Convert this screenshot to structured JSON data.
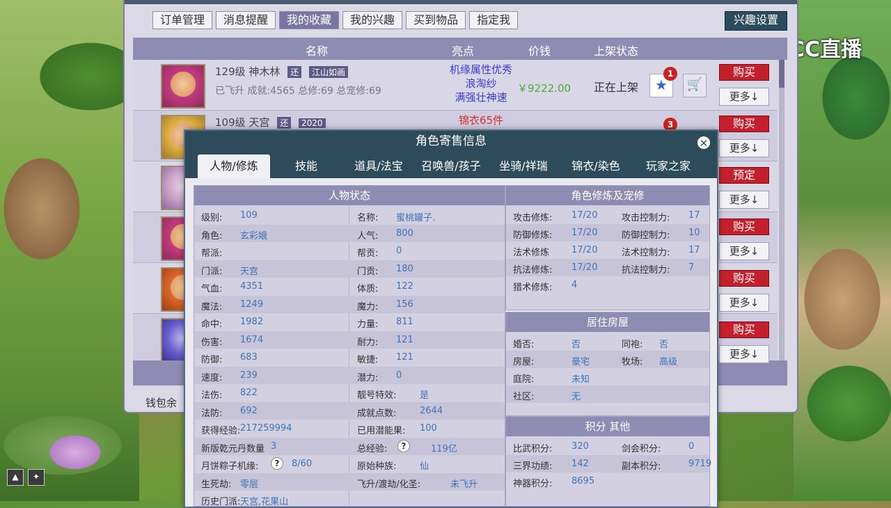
{
  "brand": {
    "logo_text": "CC直播"
  },
  "main": {
    "tabs": [
      {
        "label": "订单管理",
        "active": false
      },
      {
        "label": "消息提醒",
        "active": false
      },
      {
        "label": "我的收藏",
        "active": true
      },
      {
        "label": "我的兴趣",
        "active": false
      },
      {
        "label": "买到物品",
        "active": false
      },
      {
        "label": "指定我",
        "active": false
      }
    ],
    "interest_button": "兴趣设置",
    "columns": {
      "name": "名称",
      "highlight": "亮点",
      "price": "价钱",
      "status": "上架状态"
    },
    "rows": [
      {
        "level": "129级",
        "name": "神木林",
        "badge1": "还",
        "badge2": "江山如画",
        "meta": "已飞升  成就:4565  总修:69  总宠修:69",
        "highlights": [
          "机缘属性优秀",
          "浪淘纱",
          "满强壮神速"
        ],
        "price": "￥9222.00",
        "status": "正在上架",
        "fav_count": "1",
        "buy": "购买",
        "more": "更多↓"
      },
      {
        "level": "109级",
        "name": "天宫",
        "badge1": "还",
        "badge2": "2020",
        "meta": "",
        "highlights": [
          "锦衣65件"
        ],
        "price": "",
        "status": "",
        "fav_count": "3",
        "buy": "购买",
        "more": "更多↓"
      }
    ],
    "side_buttons": [
      {
        "buy": "购买",
        "more": "更多↓"
      },
      {
        "buy": "购买",
        "more": "更多↓"
      },
      {
        "buy": "预定",
        "more": "更多↓"
      },
      {
        "buy": "购买",
        "more": "更多↓"
      },
      {
        "buy": "购买",
        "more": "更多↓"
      },
      {
        "buy": "购买",
        "more": "更多↓"
      }
    ],
    "wallet_label": "钱包余"
  },
  "modal": {
    "title": "角色寄售信息",
    "tabs": [
      "人物/修炼",
      "技能",
      "道具/法宝",
      "召唤兽/孩子",
      "坐骑/祥瑞",
      "锦衣/染色",
      "玩家之家"
    ],
    "status_title": "人物状态",
    "status_left": [
      {
        "k": "级别:",
        "v": "109"
      },
      {
        "k": "角色:",
        "v": "玄彩娥"
      },
      {
        "k": "帮派:",
        "v": ""
      },
      {
        "k": "门派:",
        "v": "天宫"
      },
      {
        "k": "气血:",
        "v": "4351"
      },
      {
        "k": "魔法:",
        "v": "1249"
      },
      {
        "k": "命中:",
        "v": "1982"
      },
      {
        "k": "伤害:",
        "v": "1674"
      },
      {
        "k": "防御:",
        "v": "683"
      },
      {
        "k": "速度:",
        "v": "239"
      },
      {
        "k": "法伤:",
        "v": "822"
      },
      {
        "k": "法防:",
        "v": "692"
      },
      {
        "k": "获得经验:",
        "v": "217259994"
      },
      {
        "k": "新版乾元丹数量",
        "v": "3"
      },
      {
        "k": "月饼粽子机缘:",
        "v": "8/60",
        "q": true
      },
      {
        "k": "生死劫:",
        "v": "零层"
      },
      {
        "k": "历史门派:",
        "v": "天宫,花果山"
      }
    ],
    "status_right": [
      {
        "k": "名称:",
        "v": "蜜桃罐子."
      },
      {
        "k": "人气:",
        "v": "800"
      },
      {
        "k": "帮贡:",
        "v": "0"
      },
      {
        "k": "门贡:",
        "v": "180"
      },
      {
        "k": "体质:",
        "v": "122"
      },
      {
        "k": "魔力:",
        "v": "156"
      },
      {
        "k": "力量:",
        "v": "811"
      },
      {
        "k": "耐力:",
        "v": "121"
      },
      {
        "k": "敏捷:",
        "v": "121"
      },
      {
        "k": "潜力:",
        "v": "0"
      },
      {
        "k": "靓号特效:",
        "v": "是"
      },
      {
        "k": "成就点数:",
        "v": "2644"
      },
      {
        "k": "已用潜能果:",
        "v": "100"
      },
      {
        "k": "总经验:",
        "v": "119亿",
        "q": true
      },
      {
        "k": "原始种族:",
        "v": "仙"
      },
      {
        "k": "飞升/渡劫/化圣:",
        "v": "未飞升"
      }
    ],
    "cultivation_title": "角色修炼及宠修",
    "cultivation": [
      {
        "k1": "攻击修炼:",
        "v1": "17/20",
        "k2": "攻击控制力:",
        "v2": "17"
      },
      {
        "k1": "防御修炼:",
        "v1": "17/20",
        "k2": "防御控制力:",
        "v2": "10"
      },
      {
        "k1": "法术修炼",
        "v1": "17/20",
        "k2": "法术控制力:",
        "v2": "17"
      },
      {
        "k1": "抗法修炼:",
        "v1": "17/20",
        "k2": "抗法控制力:",
        "v2": "7"
      },
      {
        "k1": "猎术修炼:",
        "v1": "4",
        "k2": "",
        "v2": ""
      }
    ],
    "house_title": "居住房屋",
    "house": [
      {
        "k1": "婚否:",
        "v1": "否",
        "k2": "同袍:",
        "v2": "否"
      },
      {
        "k1": "房屋:",
        "v1": "豪宅",
        "k2": "牧场:",
        "v2": "高级"
      },
      {
        "k1": "庭院:",
        "v1": "未知",
        "k2": "",
        "v2": ""
      },
      {
        "k1": "社区:",
        "v1": "无",
        "k2": "",
        "v2": ""
      }
    ],
    "score_title": "积分 其他",
    "score": [
      {
        "k1": "比武积分:",
        "v1": "320",
        "k2": "剑会积分:",
        "v2": "0"
      },
      {
        "k1": "三界功绩:",
        "v1": "142",
        "k2": "副本积分:",
        "v2": "9719"
      },
      {
        "k1": "神器积分:",
        "v1": "8695",
        "k2": "",
        "v2": ""
      }
    ],
    "close_glyph": "✕"
  },
  "hud": [
    "▲",
    "✦"
  ],
  "icons": [
    "star-icon",
    "cart-icon",
    "close-icon",
    "question-icon"
  ]
}
